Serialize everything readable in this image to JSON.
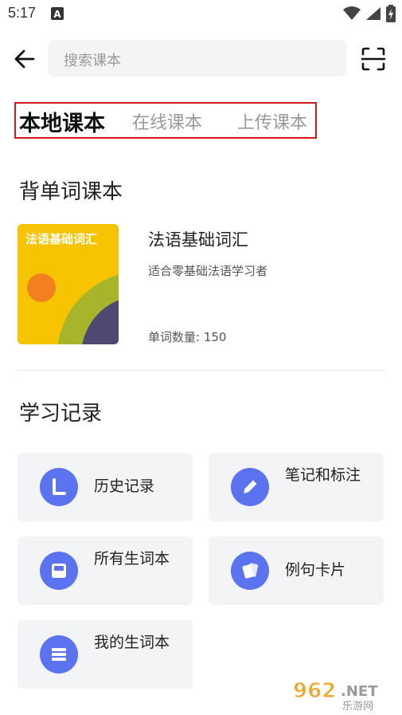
{
  "status": {
    "time": "5:17"
  },
  "search": {
    "placeholder": "搜索课本"
  },
  "tabs": [
    {
      "label": "本地课本",
      "active": true
    },
    {
      "label": "在线课本",
      "active": false
    },
    {
      "label": "上传课本",
      "active": false
    }
  ],
  "sections": {
    "vocab_books": "背单词课本",
    "study_records": "学习记录"
  },
  "book": {
    "cover_title": "法语基础词汇",
    "title": "法语基础词汇",
    "description": "适合零基础法语学习者",
    "word_count": "单词数量: 150"
  },
  "records": [
    {
      "label": "历史记录",
      "icon": "history-icon"
    },
    {
      "label": "笔记和标注",
      "icon": "pencil-icon"
    },
    {
      "label": "所有生词本",
      "icon": "notebook-icon"
    },
    {
      "label": "例句卡片",
      "icon": "cards-icon"
    },
    {
      "label": "我的生词本",
      "icon": "list-icon"
    }
  ],
  "watermark": {
    "text": "962.NET",
    "sub": "乐游网"
  },
  "colors": {
    "accent": "#5b73f0",
    "cover": "#f6c400",
    "tab_highlight": "#d21818"
  }
}
